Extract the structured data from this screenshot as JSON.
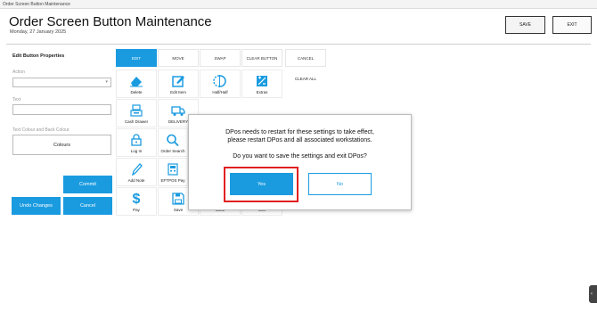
{
  "window": {
    "title": "Order Screen Button Maintenance"
  },
  "header": {
    "title": "Order Screen Button Maintenance",
    "date": "Monday, 27 January 2025",
    "save_label": "SAVE",
    "exit_label": "EXIT"
  },
  "props": {
    "heading": "Edit Button Properties",
    "action_label": "Action",
    "text_label": "Text",
    "colour_label": "Text Colour and Back Colour",
    "colours_label": "Colours",
    "commit_label": "Commit",
    "undo_label": "Undo Changes",
    "cancel_label": "Cancel"
  },
  "tabs": [
    "EDIT",
    "MOVE",
    "SWAP",
    "CLEAR BUTTON",
    "CANCEL"
  ],
  "clear_all": "CLEAR ALL",
  "grid": [
    {
      "label": "Delete",
      "icon": "eraser-icon"
    },
    {
      "label": "Edit Item",
      "icon": "edit-icon"
    },
    {
      "label": "Half/Half",
      "icon": "half-half-icon"
    },
    {
      "label": "Extras",
      "icon": "extras-icon"
    },
    {
      "label": "Cash Drawer",
      "icon": "cash-drawer-icon"
    },
    {
      "label": "DELIVERY",
      "icon": "delivery-icon"
    },
    {
      "label": "Log In",
      "icon": "lock-icon"
    },
    {
      "label": "Order Search",
      "icon": "search-icon"
    },
    {
      "label": "Add Note",
      "icon": "pen-icon"
    },
    {
      "label": "EFTPOS Pay",
      "icon": "eftpos-icon"
    },
    {
      "label": "Pay",
      "icon": "dollar-icon"
    },
    {
      "label": "Save",
      "icon": "save-icon"
    },
    {
      "label": "Clear",
      "icon": "clear-icon"
    },
    {
      "label": "Exit",
      "icon": "exit-icon"
    }
  ],
  "dialog": {
    "line1": "DPos needs to restart for these settings to take effect,",
    "line2": "please restart DPos and all associated workstations.",
    "question": "Do you want to save the settings and exit DPos?",
    "yes_label": "Yes",
    "no_label": "No"
  },
  "colors": {
    "accent": "#1a9be0",
    "highlight": "#e02020"
  }
}
